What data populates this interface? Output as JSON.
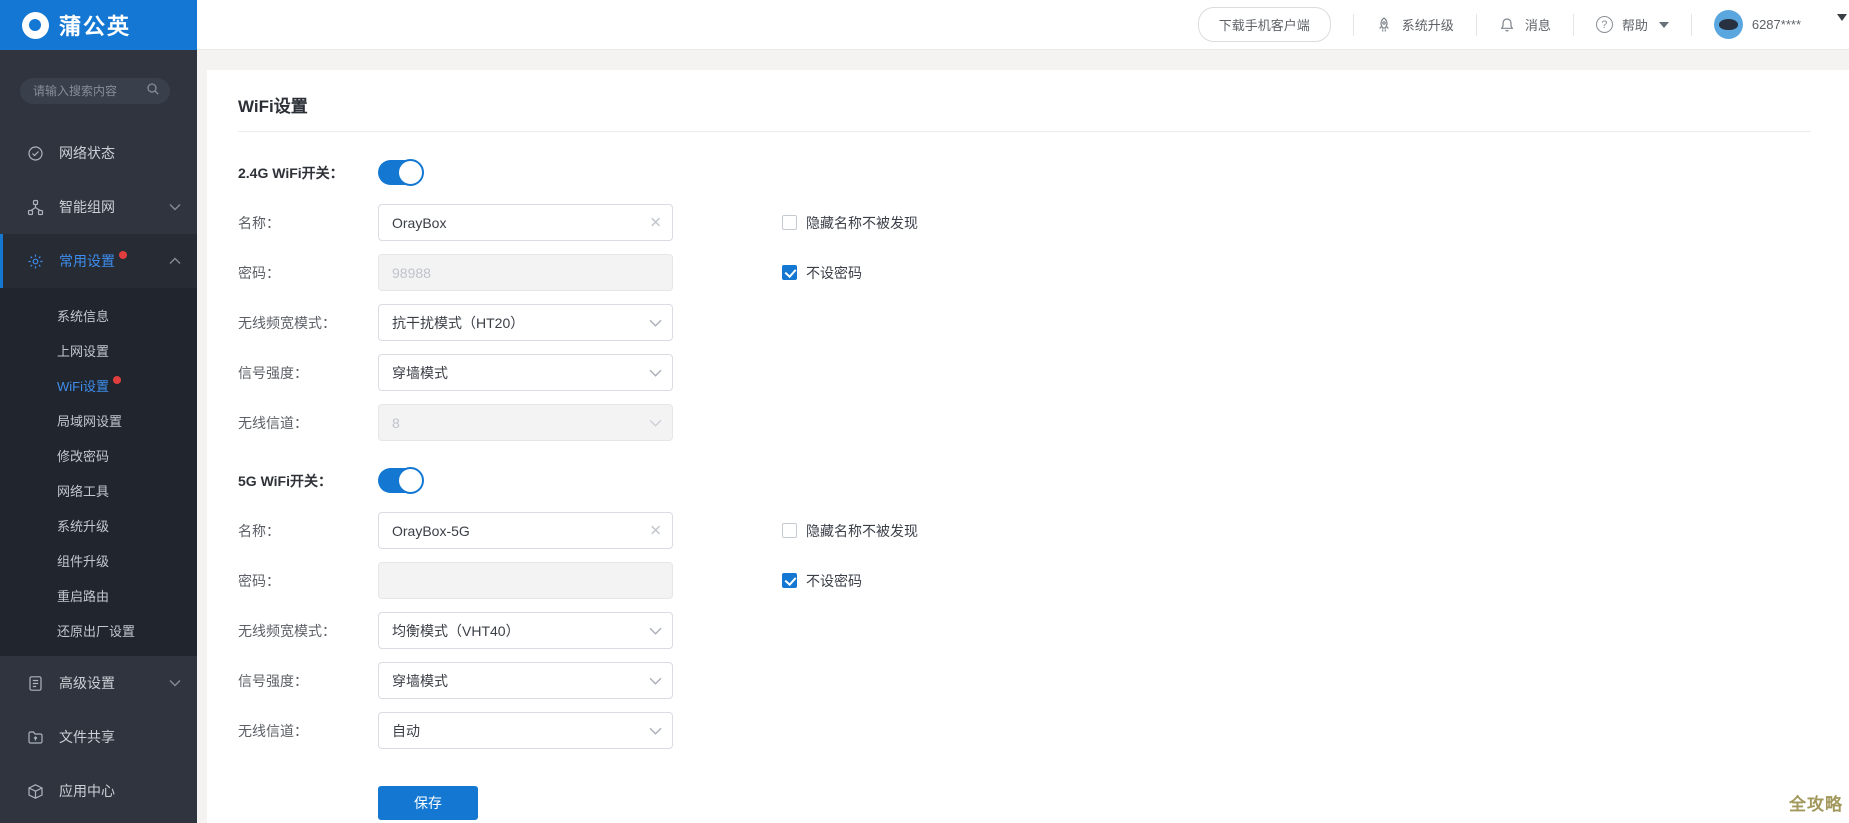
{
  "brand": {
    "logo_text": "蒲公英"
  },
  "topbar": {
    "download_label": "下载手机客户端",
    "upgrade_label": "系统升级",
    "messages_label": "消息",
    "help_label": "帮助",
    "account": "6287****"
  },
  "sidebar": {
    "search_placeholder": "请输入搜索内容",
    "items": [
      {
        "label": "网络状态"
      },
      {
        "label": "智能组网"
      },
      {
        "label": "常用设置"
      },
      {
        "label": "高级设置"
      },
      {
        "label": "文件共享"
      },
      {
        "label": "应用中心"
      }
    ],
    "submenu": [
      {
        "label": "系统信息"
      },
      {
        "label": "上网设置"
      },
      {
        "label": "WiFi设置"
      },
      {
        "label": "局域网设置"
      },
      {
        "label": "修改密码"
      },
      {
        "label": "网络工具"
      },
      {
        "label": "系统升级"
      },
      {
        "label": "组件升级"
      },
      {
        "label": "重启路由"
      },
      {
        "label": "还原出厂设置"
      }
    ]
  },
  "main": {
    "title": "WiFi设置",
    "s24": {
      "switch_label": "2.4G WiFi开关：",
      "name_label": "名称：",
      "name_value": "OrayBox",
      "hide_label": "隐藏名称不被发现",
      "pwd_label": "密码：",
      "pwd_value": "98988",
      "nopwd_label": "不设密码",
      "band_label": "无线频宽模式：",
      "band_value": "抗干扰模式（HT20）",
      "signal_label": "信号强度：",
      "signal_value": "穿墙模式",
      "channel_label": "无线信道：",
      "channel_value": "8"
    },
    "s5": {
      "switch_label": "5G WiFi开关：",
      "name_label": "名称：",
      "name_value": "OrayBox-5G",
      "hide_label": "隐藏名称不被发现",
      "pwd_label": "密码：",
      "pwd_value": "",
      "nopwd_label": "不设密码",
      "band_label": "无线频宽模式：",
      "band_value": "均衡模式（VHT40）",
      "signal_label": "信号强度：",
      "signal_value": "穿墙模式",
      "channel_label": "无线信道：",
      "channel_value": "自动"
    },
    "save_label": "保存"
  },
  "watermark": "全攻略",
  "colors": {
    "brand_blue": "#1377d3",
    "accent_blue": "#1478d2",
    "active_text_blue": "#3d8eee",
    "sidebar_bg": "#2f343e",
    "submenu_bg": "#21262e",
    "red_dot": "#e03e3e",
    "watermark": "#a2985c"
  }
}
